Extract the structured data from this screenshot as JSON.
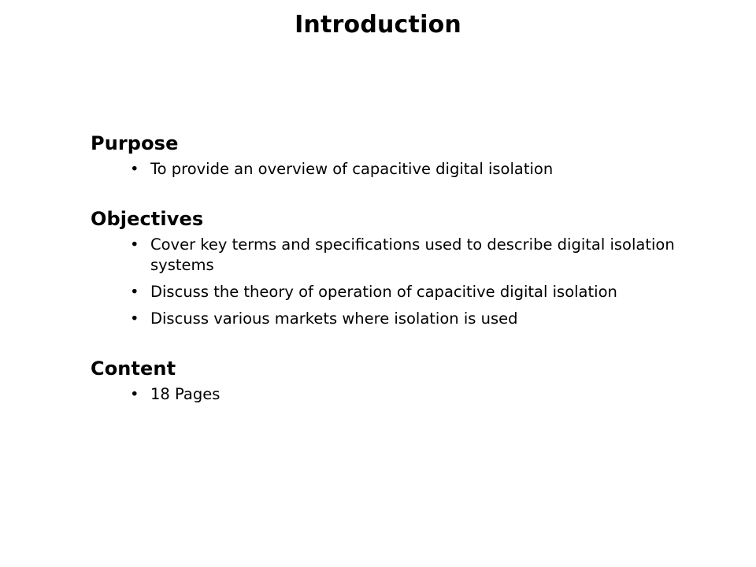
{
  "slide": {
    "title": "Introduction",
    "bullet_glyph": "•",
    "text_color": "#000000",
    "background_color": "#ffffff",
    "sections": [
      {
        "heading": "Purpose",
        "bullets": [
          "To provide an overview of capacitive digital isolation"
        ]
      },
      {
        "heading": "Objectives",
        "bullets": [
          "Cover key terms and specifications used to describe digital isolation systems",
          "Discuss the theory of operation of capacitive digital isolation",
          "Discuss various markets where isolation is used"
        ]
      },
      {
        "heading": "Content",
        "bullets": [
          "18 Pages"
        ]
      }
    ]
  }
}
